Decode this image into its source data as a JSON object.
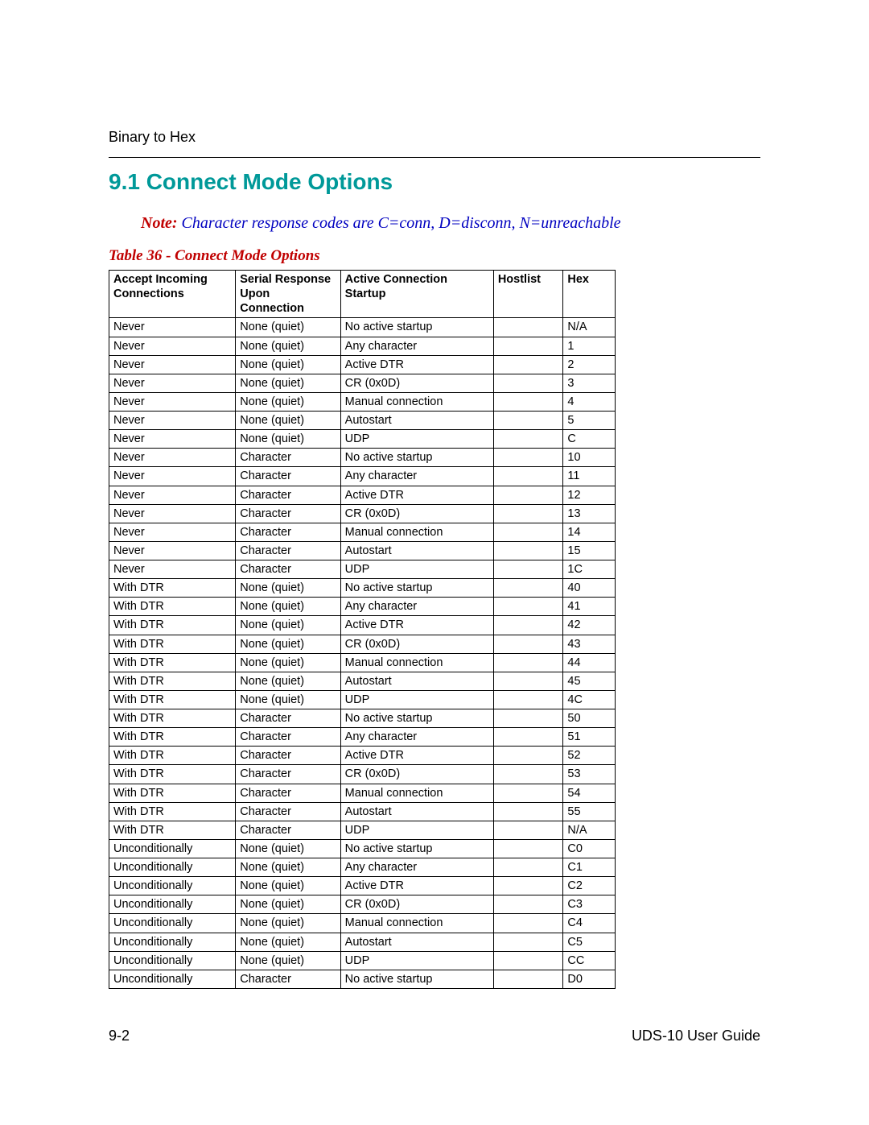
{
  "breadcrumb": "Binary to Hex",
  "section_heading": "9.1 Connect Mode Options",
  "note_label": "Note:",
  "note_text": " Character response codes are C=conn, D=disconn, N=unreachable",
  "table_caption": "Table 36 - Connect Mode Options",
  "headers": {
    "accept": "Accept Incoming Connections",
    "serial": "Serial Response Upon Connection",
    "startup": "Active Connection Startup",
    "hostlist": "Hostlist",
    "hex": "Hex"
  },
  "rows": [
    {
      "accept": "Never",
      "serial": "None (quiet)",
      "startup": "No active startup",
      "hostlist": "",
      "hex": "N/A"
    },
    {
      "accept": "Never",
      "serial": "None (quiet)",
      "startup": "Any character",
      "hostlist": "",
      "hex": "1"
    },
    {
      "accept": "Never",
      "serial": "None (quiet)",
      "startup": "Active DTR",
      "hostlist": "",
      "hex": "2"
    },
    {
      "accept": "Never",
      "serial": "None (quiet)",
      "startup": "CR (0x0D)",
      "hostlist": "",
      "hex": "3"
    },
    {
      "accept": "Never",
      "serial": "None (quiet)",
      "startup": "Manual connection",
      "hostlist": "",
      "hex": "4"
    },
    {
      "accept": "Never",
      "serial": "None (quiet)",
      "startup": "Autostart",
      "hostlist": "",
      "hex": "5"
    },
    {
      "accept": "Never",
      "serial": "None (quiet)",
      "startup": "UDP",
      "hostlist": "",
      "hex": "C"
    },
    {
      "accept": "Never",
      "serial": "Character",
      "startup": "No active startup",
      "hostlist": "",
      "hex": "10"
    },
    {
      "accept": "Never",
      "serial": "Character",
      "startup": "Any character",
      "hostlist": "",
      "hex": "11"
    },
    {
      "accept": "Never",
      "serial": "Character",
      "startup": "Active DTR",
      "hostlist": "",
      "hex": "12"
    },
    {
      "accept": "Never",
      "serial": "Character",
      "startup": "CR (0x0D)",
      "hostlist": "",
      "hex": "13"
    },
    {
      "accept": "Never",
      "serial": "Character",
      "startup": "Manual connection",
      "hostlist": "",
      "hex": "14"
    },
    {
      "accept": "Never",
      "serial": "Character",
      "startup": "Autostart",
      "hostlist": "",
      "hex": "15"
    },
    {
      "accept": "Never",
      "serial": "Character",
      "startup": "UDP",
      "hostlist": "",
      "hex": "1C"
    },
    {
      "accept": "With DTR",
      "serial": "None (quiet)",
      "startup": "No active startup",
      "hostlist": "",
      "hex": "40"
    },
    {
      "accept": "With DTR",
      "serial": "None (quiet)",
      "startup": "Any character",
      "hostlist": "",
      "hex": "41"
    },
    {
      "accept": "With DTR",
      "serial": "None (quiet)",
      "startup": "Active DTR",
      "hostlist": "",
      "hex": "42"
    },
    {
      "accept": "With DTR",
      "serial": "None (quiet)",
      "startup": "CR (0x0D)",
      "hostlist": "",
      "hex": "43"
    },
    {
      "accept": "With DTR",
      "serial": "None (quiet)",
      "startup": "Manual connection",
      "hostlist": "",
      "hex": "44"
    },
    {
      "accept": "With DTR",
      "serial": "None (quiet)",
      "startup": "Autostart",
      "hostlist": "",
      "hex": "45"
    },
    {
      "accept": "With DTR",
      "serial": "None (quiet)",
      "startup": "UDP",
      "hostlist": "",
      "hex": "4C"
    },
    {
      "accept": "With DTR",
      "serial": "Character",
      "startup": "No active startup",
      "hostlist": "",
      "hex": "50"
    },
    {
      "accept": "With DTR",
      "serial": "Character",
      "startup": "Any character",
      "hostlist": "",
      "hex": "51"
    },
    {
      "accept": "With DTR",
      "serial": "Character",
      "startup": "Active DTR",
      "hostlist": "",
      "hex": "52"
    },
    {
      "accept": "With DTR",
      "serial": "Character",
      "startup": "CR (0x0D)",
      "hostlist": "",
      "hex": "53"
    },
    {
      "accept": "With DTR",
      "serial": "Character",
      "startup": "Manual connection",
      "hostlist": "",
      "hex": "54"
    },
    {
      "accept": "With DTR",
      "serial": "Character",
      "startup": "Autostart",
      "hostlist": "",
      "hex": "55"
    },
    {
      "accept": "With DTR",
      "serial": "Character",
      "startup": "UDP",
      "hostlist": "",
      "hex": "N/A"
    },
    {
      "accept": "Unconditionally",
      "serial": "None (quiet)",
      "startup": "No active startup",
      "hostlist": "",
      "hex": "C0"
    },
    {
      "accept": "Unconditionally",
      "serial": "None (quiet)",
      "startup": "Any character",
      "hostlist": "",
      "hex": "C1"
    },
    {
      "accept": "Unconditionally",
      "serial": "None (quiet)",
      "startup": "Active DTR",
      "hostlist": "",
      "hex": "C2"
    },
    {
      "accept": "Unconditionally",
      "serial": "None (quiet)",
      "startup": "CR (0x0D)",
      "hostlist": "",
      "hex": "C3"
    },
    {
      "accept": "Unconditionally",
      "serial": "None (quiet)",
      "startup": "Manual connection",
      "hostlist": "",
      "hex": "C4"
    },
    {
      "accept": "Unconditionally",
      "serial": "None (quiet)",
      "startup": "Autostart",
      "hostlist": "",
      "hex": "C5"
    },
    {
      "accept": "Unconditionally",
      "serial": "None (quiet)",
      "startup": "UDP",
      "hostlist": "",
      "hex": "CC"
    },
    {
      "accept": "Unconditionally",
      "serial": "Character",
      "startup": "No active startup",
      "hostlist": "",
      "hex": "D0"
    }
  ],
  "footer": {
    "left": "9-2",
    "right": "UDS-10 User Guide"
  }
}
